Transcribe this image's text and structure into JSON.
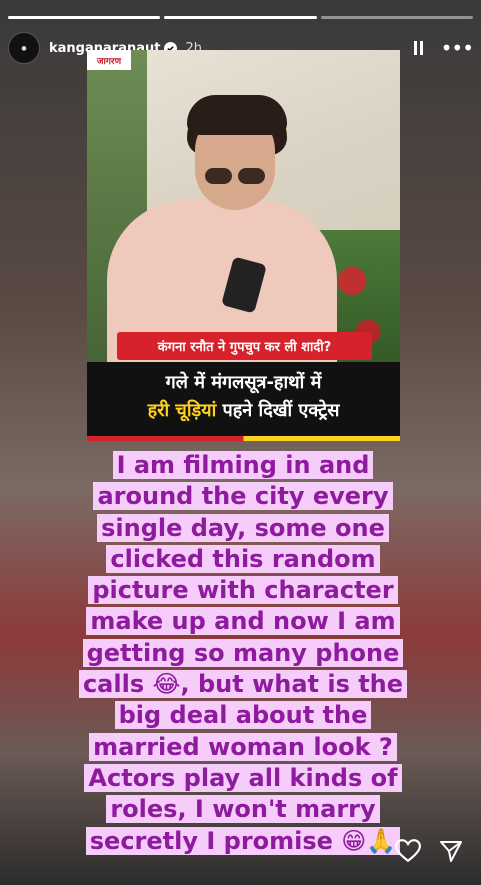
{
  "header": {
    "username": "kanganaranaut",
    "time": "2h",
    "verified_icon": "verified-badge-icon"
  },
  "photo": {
    "logo": "जागरण",
    "banner": "कंगना रनौत ने गुपचुप कर ली शादी?",
    "headline_line1": "गले में मंगलसूत्र-हाथों में",
    "headline_line2_highlight": "हरी चूड़ियां",
    "headline_line2_rest": " पहने दिखीं एक्ट्रेस"
  },
  "caption": {
    "text": "I am filming in and around the city every single day, some one clicked this random picture with character make up and now I am getting so many phone calls 😂, but what is the big deal about the married woman look ? Actors play all kinds of roles, I won't marry secretly I promise 😁🙏"
  },
  "colors": {
    "caption_text": "#8e1a9e",
    "caption_bg": "#f6cdfa",
    "banner_red": "#d7222b",
    "highlight_yellow": "#ffd21e"
  },
  "icons": {
    "pause": "pause-icon",
    "more": "more-icon",
    "like": "heart-icon",
    "share": "send-icon"
  }
}
